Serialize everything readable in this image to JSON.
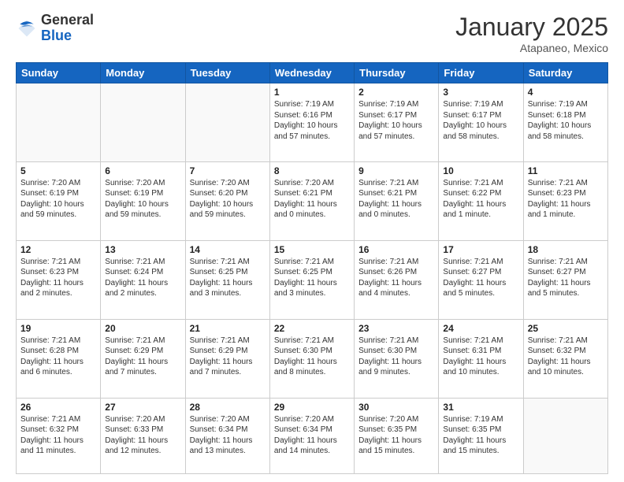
{
  "header": {
    "logo_general": "General",
    "logo_blue": "Blue",
    "month_title": "January 2025",
    "subtitle": "Atapaneo, Mexico"
  },
  "weekdays": [
    "Sunday",
    "Monday",
    "Tuesday",
    "Wednesday",
    "Thursday",
    "Friday",
    "Saturday"
  ],
  "weeks": [
    [
      {
        "day": "",
        "info": ""
      },
      {
        "day": "",
        "info": ""
      },
      {
        "day": "",
        "info": ""
      },
      {
        "day": "1",
        "info": "Sunrise: 7:19 AM\nSunset: 6:16 PM\nDaylight: 10 hours and 57 minutes."
      },
      {
        "day": "2",
        "info": "Sunrise: 7:19 AM\nSunset: 6:17 PM\nDaylight: 10 hours and 57 minutes."
      },
      {
        "day": "3",
        "info": "Sunrise: 7:19 AM\nSunset: 6:17 PM\nDaylight: 10 hours and 58 minutes."
      },
      {
        "day": "4",
        "info": "Sunrise: 7:19 AM\nSunset: 6:18 PM\nDaylight: 10 hours and 58 minutes."
      }
    ],
    [
      {
        "day": "5",
        "info": "Sunrise: 7:20 AM\nSunset: 6:19 PM\nDaylight: 10 hours and 59 minutes."
      },
      {
        "day": "6",
        "info": "Sunrise: 7:20 AM\nSunset: 6:19 PM\nDaylight: 10 hours and 59 minutes."
      },
      {
        "day": "7",
        "info": "Sunrise: 7:20 AM\nSunset: 6:20 PM\nDaylight: 10 hours and 59 minutes."
      },
      {
        "day": "8",
        "info": "Sunrise: 7:20 AM\nSunset: 6:21 PM\nDaylight: 11 hours and 0 minutes."
      },
      {
        "day": "9",
        "info": "Sunrise: 7:21 AM\nSunset: 6:21 PM\nDaylight: 11 hours and 0 minutes."
      },
      {
        "day": "10",
        "info": "Sunrise: 7:21 AM\nSunset: 6:22 PM\nDaylight: 11 hours and 1 minute."
      },
      {
        "day": "11",
        "info": "Sunrise: 7:21 AM\nSunset: 6:23 PM\nDaylight: 11 hours and 1 minute."
      }
    ],
    [
      {
        "day": "12",
        "info": "Sunrise: 7:21 AM\nSunset: 6:23 PM\nDaylight: 11 hours and 2 minutes."
      },
      {
        "day": "13",
        "info": "Sunrise: 7:21 AM\nSunset: 6:24 PM\nDaylight: 11 hours and 2 minutes."
      },
      {
        "day": "14",
        "info": "Sunrise: 7:21 AM\nSunset: 6:25 PM\nDaylight: 11 hours and 3 minutes."
      },
      {
        "day": "15",
        "info": "Sunrise: 7:21 AM\nSunset: 6:25 PM\nDaylight: 11 hours and 3 minutes."
      },
      {
        "day": "16",
        "info": "Sunrise: 7:21 AM\nSunset: 6:26 PM\nDaylight: 11 hours and 4 minutes."
      },
      {
        "day": "17",
        "info": "Sunrise: 7:21 AM\nSunset: 6:27 PM\nDaylight: 11 hours and 5 minutes."
      },
      {
        "day": "18",
        "info": "Sunrise: 7:21 AM\nSunset: 6:27 PM\nDaylight: 11 hours and 5 minutes."
      }
    ],
    [
      {
        "day": "19",
        "info": "Sunrise: 7:21 AM\nSunset: 6:28 PM\nDaylight: 11 hours and 6 minutes."
      },
      {
        "day": "20",
        "info": "Sunrise: 7:21 AM\nSunset: 6:29 PM\nDaylight: 11 hours and 7 minutes."
      },
      {
        "day": "21",
        "info": "Sunrise: 7:21 AM\nSunset: 6:29 PM\nDaylight: 11 hours and 7 minutes."
      },
      {
        "day": "22",
        "info": "Sunrise: 7:21 AM\nSunset: 6:30 PM\nDaylight: 11 hours and 8 minutes."
      },
      {
        "day": "23",
        "info": "Sunrise: 7:21 AM\nSunset: 6:30 PM\nDaylight: 11 hours and 9 minutes."
      },
      {
        "day": "24",
        "info": "Sunrise: 7:21 AM\nSunset: 6:31 PM\nDaylight: 11 hours and 10 minutes."
      },
      {
        "day": "25",
        "info": "Sunrise: 7:21 AM\nSunset: 6:32 PM\nDaylight: 11 hours and 10 minutes."
      }
    ],
    [
      {
        "day": "26",
        "info": "Sunrise: 7:21 AM\nSunset: 6:32 PM\nDaylight: 11 hours and 11 minutes."
      },
      {
        "day": "27",
        "info": "Sunrise: 7:20 AM\nSunset: 6:33 PM\nDaylight: 11 hours and 12 minutes."
      },
      {
        "day": "28",
        "info": "Sunrise: 7:20 AM\nSunset: 6:34 PM\nDaylight: 11 hours and 13 minutes."
      },
      {
        "day": "29",
        "info": "Sunrise: 7:20 AM\nSunset: 6:34 PM\nDaylight: 11 hours and 14 minutes."
      },
      {
        "day": "30",
        "info": "Sunrise: 7:20 AM\nSunset: 6:35 PM\nDaylight: 11 hours and 15 minutes."
      },
      {
        "day": "31",
        "info": "Sunrise: 7:19 AM\nSunset: 6:35 PM\nDaylight: 11 hours and 15 minutes."
      },
      {
        "day": "",
        "info": ""
      }
    ]
  ]
}
